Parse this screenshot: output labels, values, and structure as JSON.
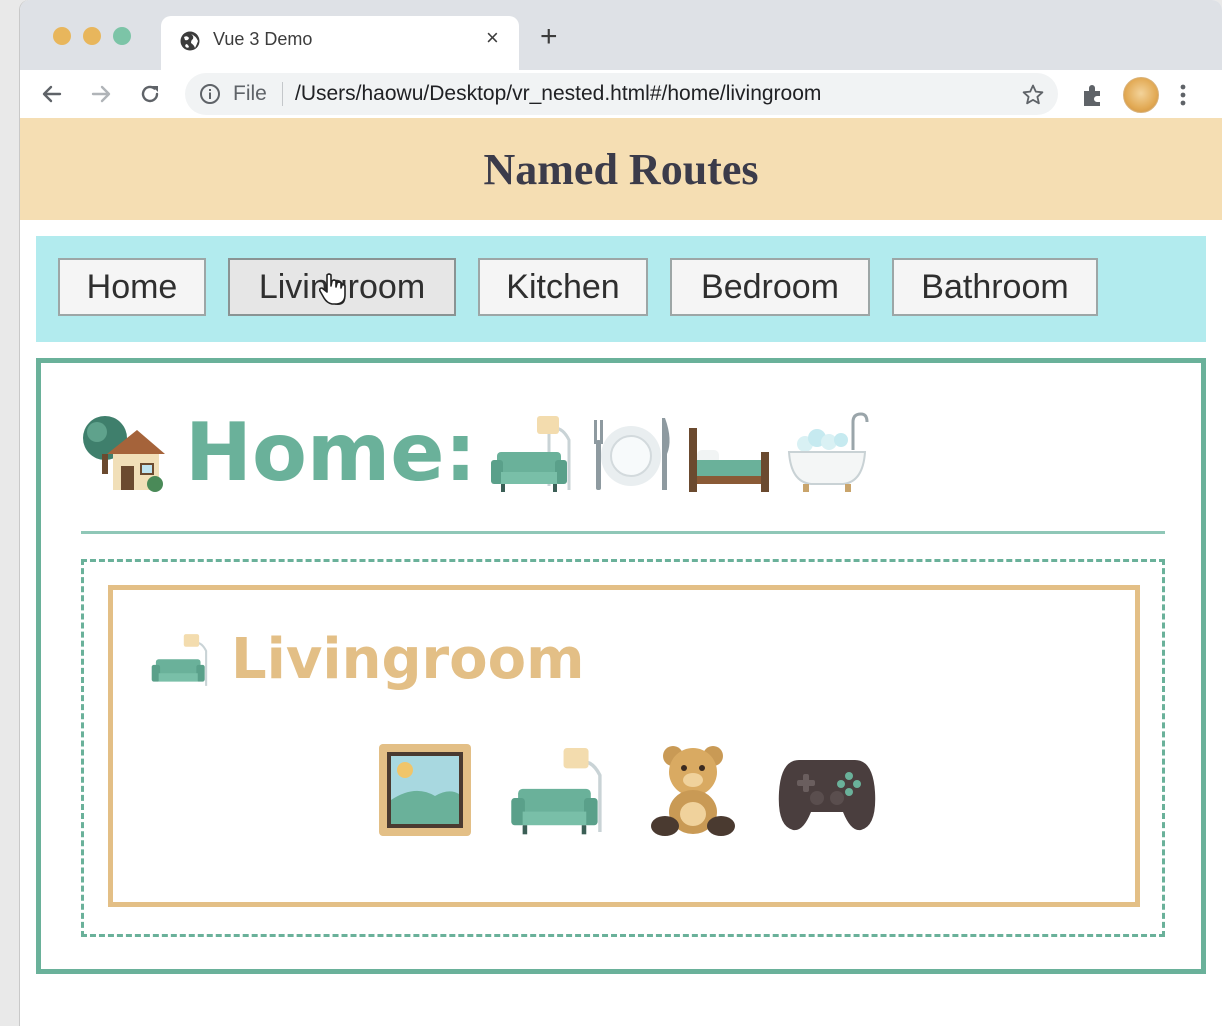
{
  "browser": {
    "tab_title": "Vue 3 Demo",
    "new_tab_symbol": "+",
    "close_symbol": "×",
    "scheme_label": "File",
    "url": "/Users/haowu/Desktop/vr_nested.html#/home/livingroom",
    "traffic_light_colors": [
      "#e8b65c",
      "#e8b65c",
      "#7cc4a7"
    ]
  },
  "header": {
    "title": "Named Routes"
  },
  "nav": {
    "buttons": [
      {
        "label": "Home",
        "active": false
      },
      {
        "label": "Livingroom",
        "active": true
      },
      {
        "label": "Kitchen",
        "active": false
      },
      {
        "label": "Bedroom",
        "active": false
      },
      {
        "label": "Bathroom",
        "active": false
      }
    ]
  },
  "home_view": {
    "title": "Home:",
    "icons": [
      "house-with-garden-icon",
      "couch-and-lamp-icon",
      "fork-knife-plate-icon",
      "bed-icon",
      "bathtub-icon"
    ]
  },
  "room_view": {
    "title": "Livingroom",
    "icons": [
      "framed-picture-icon",
      "couch-and-lamp-icon",
      "teddy-bear-icon",
      "game-controller-icon"
    ]
  },
  "colors": {
    "header_bg": "#f5deb3",
    "nav_bg": "#b2ebee",
    "home_accent": "#6ab19a",
    "room_accent": "#e3bf86"
  }
}
